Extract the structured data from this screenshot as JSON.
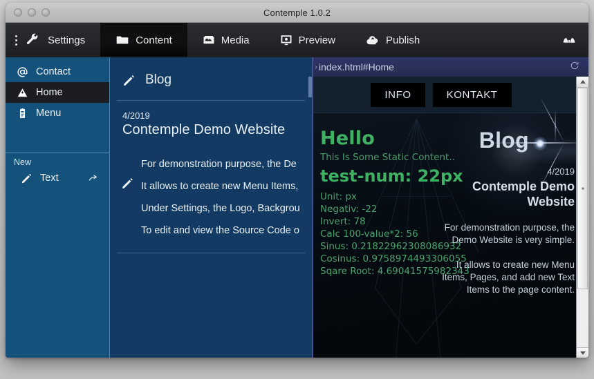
{
  "window": {
    "title": "Contemple 1.0.2",
    "traffic_lights": [
      "close",
      "minimize",
      "zoom"
    ]
  },
  "toolbar": {
    "menu_icon": "kebab-menu-icon",
    "items": [
      {
        "label": "Settings",
        "icon": "wrench-icon",
        "active": false
      },
      {
        "label": "Content",
        "icon": "folder-icon",
        "active": true
      },
      {
        "label": "Media",
        "icon": "image-box-icon",
        "active": false
      },
      {
        "label": "Preview",
        "icon": "monitor-icon",
        "active": false
      },
      {
        "label": "Publish",
        "icon": "cloud-upload-icon",
        "active": false
      }
    ],
    "right_icon": "binoculars-icon"
  },
  "sidebar": {
    "pages": [
      {
        "label": "Contact",
        "icon": "at-sign-icon",
        "active": false
      },
      {
        "label": "Home",
        "icon": "mountain-icon",
        "active": true
      },
      {
        "label": "Menu",
        "icon": "clipboard-icon",
        "active": false
      }
    ],
    "new_section_label": "New",
    "new_items": [
      {
        "label": "Text",
        "icon": "pencil-icon",
        "action_icon": "share-arrow-icon"
      }
    ]
  },
  "content": {
    "page_title": "Blog",
    "page_title_icon": "pencil-icon",
    "entry": {
      "date": "4/2019",
      "title": "Contemple Demo Website",
      "edit_icon": "pencil-icon",
      "lines": [
        "For demonstration purpose, the De",
        "It allows to create new Menu Items,",
        "Under Settings, the Logo, Backgrou",
        "To edit and view the Source Code o"
      ]
    }
  },
  "preview": {
    "url": "index.html#Home",
    "reload_icon": "reload-icon",
    "nav_buttons": [
      "INFO",
      "KONTAKT"
    ],
    "site": {
      "heading": "Blog",
      "article": {
        "date": "4/2019",
        "title": "Contemple Demo Website",
        "paragraphs": [
          "For demonstration purpose, the Demo Website is very simple.",
          "It allows to create new Menu Items, Pages, and add new Text Items to the page content."
        ]
      },
      "static_block": {
        "hello": "Hello",
        "subtitle": "This Is Some Static Content..",
        "test_num": "test-num: 22px",
        "values": [
          "Unit: px",
          "Negativ: -22",
          "Invert: 78",
          "Calc 100-value*2: 56",
          "Sinus: 0.21822962308086932",
          "Cosinus: 0.9758974493306055",
          "Sqare Root: 4.69041575982343"
        ]
      }
    },
    "scrollbar": {
      "up_icon": "scroll-up-arrow-icon",
      "down_icon": "scroll-down-arrow-icon"
    }
  },
  "colors": {
    "sidebar_blue": "#14527b",
    "content_blue": "#123a62",
    "toolbar_dark": "#232529",
    "accent_green": "#3eb163",
    "url_bar": "#2e3569"
  }
}
